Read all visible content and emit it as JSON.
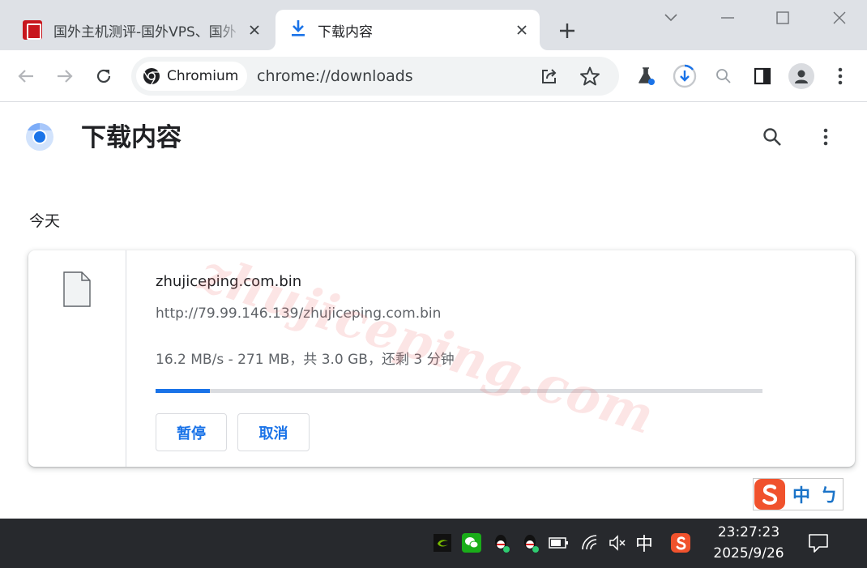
{
  "tabs": [
    {
      "title": "国外主机测评-国外VPS、国外",
      "active": false
    },
    {
      "title": "下载内容",
      "active": true
    }
  ],
  "omnibox": {
    "chip_label": "Chromium",
    "url": "chrome://downloads"
  },
  "page": {
    "title": "下载内容",
    "section_date": "今天"
  },
  "watermark": "zhujiceping.com",
  "download": {
    "file_name": "zhujiceping.com.bin",
    "url": "http://79.99.146.139/zhujiceping.com.bin",
    "status": "16.2 MB/s - 271 MB，共 3.0 GB，还剩 3 分钟",
    "progress_fraction": 0.09,
    "pause_label": "暂停",
    "cancel_label": "取消"
  },
  "ime": {
    "lang": "中",
    "punct": "ㄅ"
  },
  "taskbar": {
    "lang_indicator": "中",
    "time": "23:27:23",
    "date": "2025/9/26"
  },
  "colors": {
    "accent": "#1a73e8",
    "tabstrip": "#dee1e6",
    "taskbar": "#27292d",
    "sogou": "#f0522d"
  }
}
